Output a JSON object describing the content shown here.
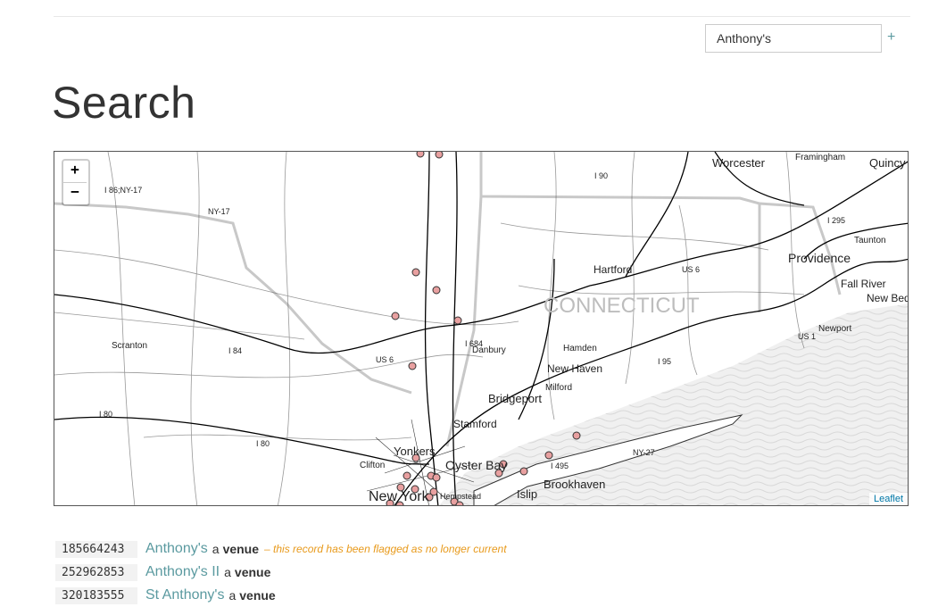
{
  "search": {
    "value": "Anthony's",
    "add_label": "+"
  },
  "page_title": "Search",
  "map": {
    "zoom_in": "+",
    "zoom_out": "−",
    "attribution": "Leaflet",
    "labels": {
      "worcester": "Worcester",
      "framingham": "Framingham",
      "quincy": "Quincy",
      "hartford": "Hartford",
      "providence": "Providence",
      "taunton": "Taunton",
      "fall_river": "Fall River",
      "new_bedford": "New Bed",
      "newport": "Newport",
      "connecticut": "CONNECTICUT",
      "danbury": "Danbury",
      "hamden": "Hamden",
      "new_haven": "New Haven",
      "milford": "Milford",
      "bridgeport": "Bridgeport",
      "stamford": "Stamford",
      "yonkers": "Yonkers",
      "oyster_bay": "Oyster Bay",
      "brookhaven": "Brookhaven",
      "islip": "Islip",
      "new_york": "New York",
      "hempstead": "Hempstead",
      "clifton": "Clifton",
      "scranton": "Scranton",
      "us6_a": "US 6",
      "us6_b": "US 6",
      "i84": "I 84",
      "i80": "I 80",
      "i80b": "I 80",
      "ny17": "NY-17",
      "i86": "I 86;NY-17",
      "i90": "I 90",
      "i495": "I 495",
      "i95": "I 95",
      "i295": "I 295",
      "ny27": "NY-27",
      "i684": "I 684",
      "us1": "US 1"
    },
    "marker_color": "#e8a0a0"
  },
  "results": [
    {
      "id": "185664243",
      "name": "Anthony's",
      "a": "a",
      "type": "venue",
      "flag": "– this record has been flagged as no longer current"
    },
    {
      "id": "252962853",
      "name": "Anthony's II",
      "a": "a",
      "type": "venue",
      "flag": ""
    },
    {
      "id": "320183555",
      "name": "St Anthony's",
      "a": "a",
      "type": "venue",
      "flag": ""
    }
  ]
}
